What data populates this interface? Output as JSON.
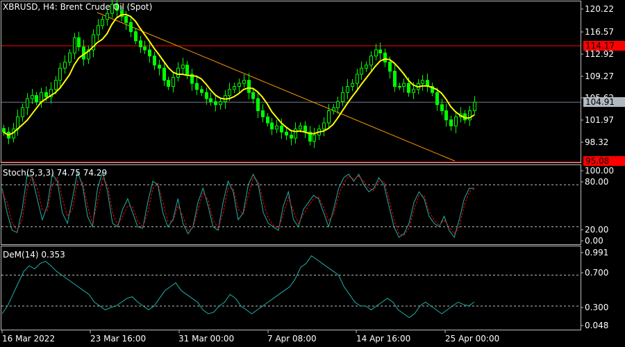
{
  "main_pane": {
    "title": "XBRUSD, H4:  Brent Crude Oil (Spot)",
    "price_ticks": [
      "120.22",
      "116.57",
      "112.92",
      "109.27",
      "105.62",
      "101.97",
      "98.32"
    ],
    "current_price": "104.91",
    "resistance_level": "114.17",
    "support_level": "95.08",
    "colors": {
      "candles": "#00ff00",
      "moving_average": "#ffff00",
      "trendline": "#ff9900",
      "hline": "#ff0000",
      "current_line": "#708090"
    }
  },
  "stoch_pane": {
    "title": "Stoch(5,3,3) 74.75 74.29",
    "ticks": [
      "100.00",
      "80.00",
      "20.00",
      "0.00"
    ],
    "colors": {
      "main": "#20b2aa",
      "signal": "#ff0000"
    }
  },
  "dem_pane": {
    "title": "DeM(14) 0.353",
    "ticks": [
      "0.991",
      "0.700",
      "0.300",
      "0.048"
    ],
    "colors": {
      "line": "#20b2aa"
    }
  },
  "time_axis": [
    "16 Mar 2022",
    "23 Mar 16:00",
    "31 Mar 00:00",
    "7 Apr 08:00",
    "14 Apr 16:00",
    "25 Apr 00:00"
  ],
  "chart_data": [
    {
      "type": "candlestick",
      "title": "XBRUSD, H4:  Brent Crude Oil (Spot)",
      "ylim": [
        96.0,
        121.5
      ],
      "series": [
        {
          "name": "price_close_approx",
          "values": [
            100.0,
            99.0,
            100.5,
            102.5,
            104.0,
            105.5,
            106.0,
            105.0,
            106.5,
            105.8,
            107.0,
            108.5,
            110.5,
            111.5,
            113.0,
            115.5,
            114.0,
            112.0,
            113.5,
            116.0,
            117.5,
            118.5,
            119.5,
            121.0,
            120.0,
            119.0,
            118.0,
            116.5,
            115.0,
            114.0,
            113.5,
            112.5,
            111.0,
            110.5,
            108.5,
            107.5,
            109.0,
            110.5,
            111.0,
            109.5,
            108.0,
            107.0,
            106.5,
            105.5,
            105.0,
            104.5,
            105.0,
            106.0,
            107.0,
            107.5,
            108.0,
            108.5,
            106.5,
            105.5,
            103.5,
            102.5,
            101.5,
            100.5,
            101.0,
            100.0,
            99.5,
            99.0,
            100.5,
            101.0,
            100.0,
            98.5,
            99.5,
            100.5,
            101.5,
            103.5,
            104.0,
            105.0,
            106.5,
            107.5,
            108.0,
            109.5,
            110.5,
            111.0,
            112.5,
            113.5,
            113.0,
            111.5,
            110.0,
            107.5,
            107.5,
            108.0,
            106.5,
            107.0,
            108.0,
            108.5,
            107.5,
            106.5,
            104.5,
            103.5,
            102.0,
            101.0,
            102.5,
            103.0,
            102.0,
            103.5,
            104.91
          ]
        }
      ]
    },
    {
      "type": "line",
      "title": "Stoch(5,3,3) 74.75 74.29",
      "ylim": [
        0,
        100
      ],
      "series": [
        {
          "name": "stoch_main",
          "values": [
            75,
            40,
            15,
            12,
            45,
            95,
            90,
            60,
            30,
            50,
            95,
            85,
            40,
            25,
            60,
            98,
            80,
            35,
            20,
            75,
            98,
            70,
            25,
            20,
            45,
            60,
            40,
            20,
            18,
            55,
            85,
            80,
            40,
            20,
            30,
            60,
            25,
            10,
            20,
            55,
            75,
            50,
            20,
            15,
            55,
            85,
            70,
            30,
            40,
            80,
            95,
            80,
            40,
            25,
            20,
            15,
            50,
            70,
            30,
            20,
            45,
            55,
            65,
            60,
            40,
            20,
            45,
            75,
            90,
            95,
            85,
            95,
            80,
            70,
            75,
            90,
            80,
            50,
            20,
            5,
            10,
            25,
            55,
            70,
            60,
            35,
            25,
            20,
            35,
            15,
            5,
            30,
            60,
            75,
            75
          ]
        },
        {
          "name": "stoch_signal",
          "values": [
            70,
            55,
            25,
            15,
            30,
            75,
            92,
            75,
            45,
            42,
            80,
            90,
            60,
            35,
            45,
            85,
            85,
            50,
            25,
            55,
            90,
            80,
            40,
            22,
            35,
            50,
            48,
            28,
            20,
            40,
            75,
            82,
            55,
            28,
            28,
            50,
            35,
            15,
            18,
            45,
            68,
            58,
            30,
            18,
            40,
            75,
            75,
            45,
            38,
            65,
            90,
            85,
            55,
            32,
            22,
            18,
            38,
            62,
            42,
            25,
            38,
            50,
            60,
            62,
            48,
            28,
            38,
            65,
            82,
            92,
            88,
            92,
            85,
            75,
            72,
            85,
            85,
            60,
            30,
            10,
            8,
            18,
            45,
            65,
            65,
            42,
            30,
            22,
            30,
            20,
            10,
            20,
            50,
            70,
            74
          ]
        }
      ]
    },
    {
      "type": "line",
      "title": "DeM(14) 0.353",
      "ylim": [
        0.048,
        0.991
      ],
      "series": [
        {
          "name": "DeM(14)",
          "values": [
            0.2,
            0.3,
            0.45,
            0.6,
            0.75,
            0.82,
            0.78,
            0.85,
            0.88,
            0.82,
            0.75,
            0.7,
            0.65,
            0.6,
            0.55,
            0.5,
            0.45,
            0.35,
            0.3,
            0.25,
            0.28,
            0.3,
            0.35,
            0.4,
            0.42,
            0.35,
            0.3,
            0.25,
            0.3,
            0.4,
            0.5,
            0.55,
            0.6,
            0.5,
            0.45,
            0.4,
            0.35,
            0.25,
            0.2,
            0.22,
            0.3,
            0.35,
            0.45,
            0.4,
            0.3,
            0.25,
            0.2,
            0.25,
            0.3,
            0.35,
            0.4,
            0.45,
            0.5,
            0.55,
            0.65,
            0.8,
            0.85,
            0.95,
            0.9,
            0.85,
            0.8,
            0.75,
            0.7,
            0.55,
            0.45,
            0.35,
            0.3,
            0.3,
            0.25,
            0.3,
            0.35,
            0.4,
            0.35,
            0.25,
            0.2,
            0.15,
            0.2,
            0.3,
            0.35,
            0.3,
            0.25,
            0.2,
            0.25,
            0.3,
            0.35,
            0.32,
            0.3,
            0.353
          ]
        }
      ]
    }
  ]
}
